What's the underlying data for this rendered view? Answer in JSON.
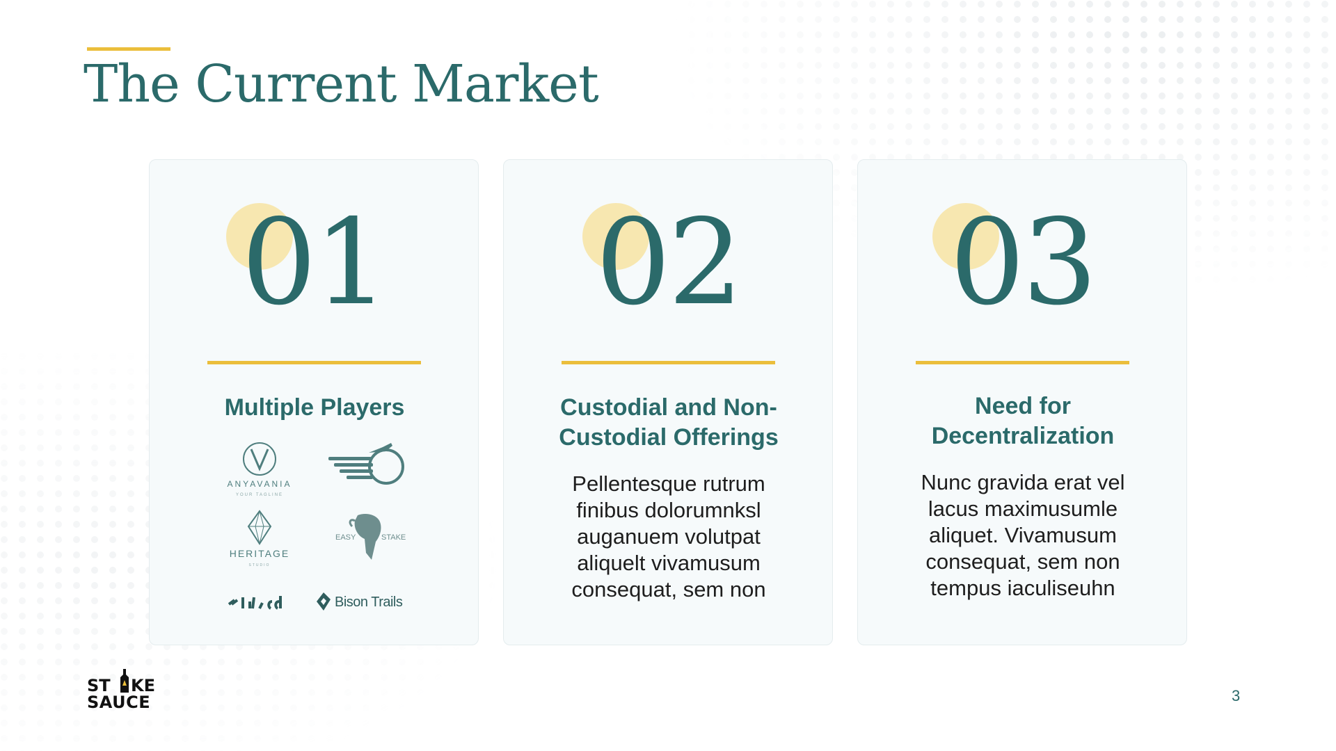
{
  "slide": {
    "title": "The Current Market",
    "page_number": "3"
  },
  "cards": [
    {
      "number": "01",
      "heading": "Multiple Players",
      "logos": [
        {
          "name": "ANYAVANIA",
          "tagline": "YOUR TAGLINE"
        },
        {
          "name": "speed-plane-logo"
        },
        {
          "name": "HERITAGE",
          "tagline": "STUDIO"
        },
        {
          "name": "EASY STAKE",
          "left": "EASY",
          "right": "STAKE"
        },
        {
          "name": "staked"
        },
        {
          "name": "Bison Trails"
        }
      ]
    },
    {
      "number": "02",
      "heading_line1": "Custodial and Non-",
      "heading_line2": "Custodial Offerings",
      "text_lines": [
        "Pellentesque rutrum",
        "finibus dolorumnksl",
        "auganuem volutpat",
        "aliquelt vivamusum",
        "consequat, sem non"
      ]
    },
    {
      "number": "03",
      "heading_line1": "Need for",
      "heading_line2": "Decentralization",
      "text_lines": [
        "Nunc gravida erat vel",
        "lacus maximusumle",
        "aliquet. Vivamusum",
        "consequat, sem non",
        "tempus iaculiseuhn"
      ]
    }
  ],
  "brand": {
    "line1_left": "ST",
    "line1_right": "KE",
    "line2": "SAUCE"
  },
  "colors": {
    "primary": "#2B6A6A",
    "accent": "#EBBE3B",
    "accent_light": "#F7E7B0",
    "card_bg": "#F6FAFB"
  }
}
